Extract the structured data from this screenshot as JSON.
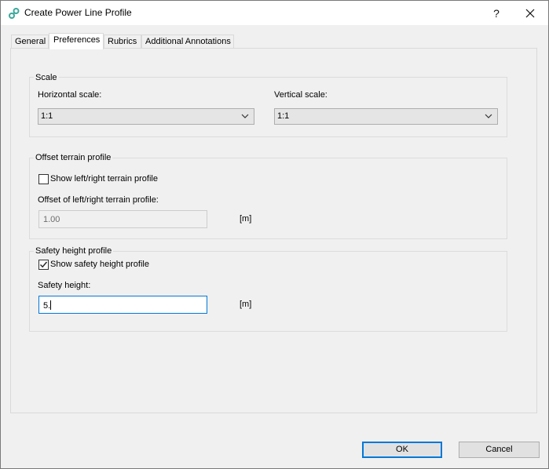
{
  "window": {
    "title": "Create Power Line Profile",
    "help_label": "?",
    "icons": {
      "app": "power-line-app-icon",
      "close": "close-icon"
    }
  },
  "tabs": [
    {
      "label": "General",
      "active": false
    },
    {
      "label": "Preferences",
      "active": true
    },
    {
      "label": "Rubrics",
      "active": false
    },
    {
      "label": "Additional Annotations",
      "active": false
    }
  ],
  "scale": {
    "title": "Scale",
    "horizontal_label": "Horizontal scale:",
    "horizontal_value": "1:1",
    "vertical_label": "Vertical scale:",
    "vertical_value": "1:1"
  },
  "offset": {
    "title": "Offset terrain profile",
    "checkbox_label": "Show left/right terrain profile",
    "checked": false,
    "field_label": "Offset of left/right terrain profile:",
    "field_value": "1.00",
    "unit": "[m]"
  },
  "safety": {
    "title": "Safety height profile",
    "checkbox_label": "Show safety height profile",
    "checked": true,
    "field_label": "Safety height:",
    "field_value": "5.",
    "unit": "[m]"
  },
  "buttons": {
    "ok": "OK",
    "cancel": "Cancel"
  },
  "colors": {
    "accent": "#0078d7",
    "app_icon": "#3aa89a"
  }
}
